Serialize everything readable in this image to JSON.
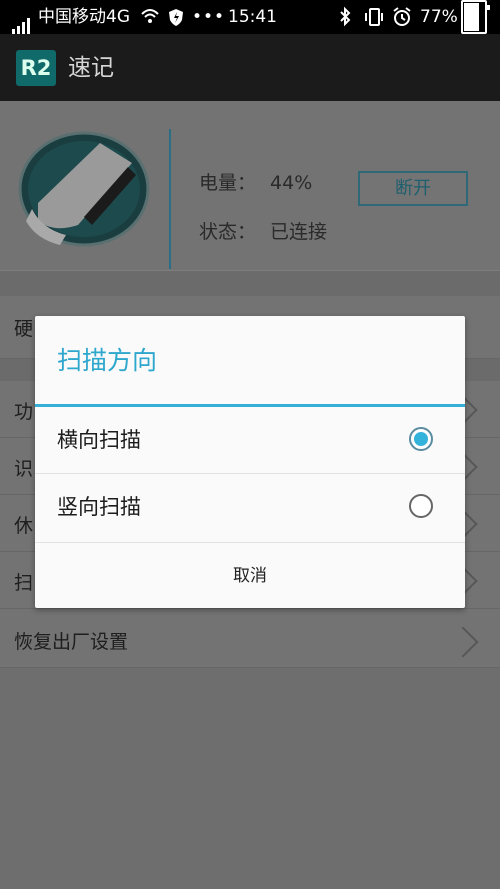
{
  "status_bar": {
    "carrier": "中国移动4G",
    "dots": "•••",
    "time": "15:41",
    "battery_percent": "77%",
    "battery_level": 0.77
  },
  "app_bar": {
    "logo_text": "R2",
    "title": "速记"
  },
  "device": {
    "battery_label": "电量：",
    "battery_value": "44%",
    "status_label": "状态：",
    "status_value": "已连接",
    "disconnect_label": "断开"
  },
  "settings": {
    "row1_partial": "硬",
    "row2_partial": "功",
    "row3_partial": "识",
    "row4_partial": "休",
    "row5_partial": "扫",
    "factory_reset": "恢复出厂设置"
  },
  "dialog": {
    "title": "扫描方向",
    "options": [
      {
        "label": "横向扫描",
        "selected": true
      },
      {
        "label": "竖向扫描",
        "selected": false
      }
    ],
    "cancel_label": "取消"
  },
  "colors": {
    "accent": "#33b2dc",
    "dialog_bg": "#fafafa",
    "logo_bg": "#116a6a"
  }
}
